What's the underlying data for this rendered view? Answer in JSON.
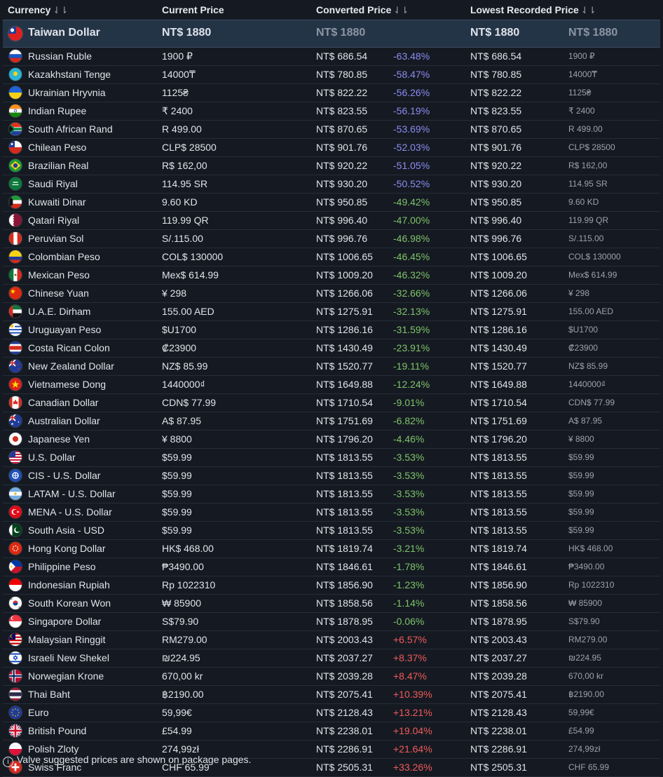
{
  "headers": {
    "currency": "Currency",
    "current": "Current Price",
    "converted": "Converted Price",
    "lowest": "Lowest Recorded Price",
    "sort_glyph": "⇃⇂"
  },
  "base": {
    "name": "Taiwan Dollar",
    "current": "NT$ 1880",
    "converted": "NT$ 1880",
    "lowest": "NT$ 1880",
    "lowest_local": "NT$ 1880",
    "flag": "tw"
  },
  "rows": [
    {
      "flag": "ru",
      "name": "Russian Ruble",
      "current": "1900 ₽",
      "converted": "NT$ 686.54",
      "pct": "-63.48%",
      "tone": "big",
      "lowest": "NT$ 686.54",
      "local": "1900 ₽"
    },
    {
      "flag": "kz",
      "name": "Kazakhstani Tenge",
      "current": "14000₸",
      "converted": "NT$ 780.85",
      "pct": "-58.47%",
      "tone": "big",
      "lowest": "NT$ 780.85",
      "local": "14000₸"
    },
    {
      "flag": "ua",
      "name": "Ukrainian Hryvnia",
      "current": "1125₴",
      "converted": "NT$ 822.22",
      "pct": "-56.26%",
      "tone": "big",
      "lowest": "NT$ 822.22",
      "local": "1125₴"
    },
    {
      "flag": "in",
      "name": "Indian Rupee",
      "current": "₹ 2400",
      "converted": "NT$ 823.55",
      "pct": "-56.19%",
      "tone": "big",
      "lowest": "NT$ 823.55",
      "local": "₹ 2400"
    },
    {
      "flag": "za",
      "name": "South African Rand",
      "current": "R 499.00",
      "converted": "NT$ 870.65",
      "pct": "-53.69%",
      "tone": "big",
      "lowest": "NT$ 870.65",
      "local": "R 499.00"
    },
    {
      "flag": "cl",
      "name": "Chilean Peso",
      "current": "CLP$ 28500",
      "converted": "NT$ 901.76",
      "pct": "-52.03%",
      "tone": "big",
      "lowest": "NT$ 901.76",
      "local": "CLP$ 28500"
    },
    {
      "flag": "br",
      "name": "Brazilian Real",
      "current": "R$ 162,00",
      "converted": "NT$ 920.22",
      "pct": "-51.05%",
      "tone": "big",
      "lowest": "NT$ 920.22",
      "local": "R$ 162,00"
    },
    {
      "flag": "sa",
      "name": "Saudi Riyal",
      "current": "114.95 SR",
      "converted": "NT$ 930.20",
      "pct": "-50.52%",
      "tone": "big",
      "lowest": "NT$ 930.20",
      "local": "114.95 SR"
    },
    {
      "flag": "kw",
      "name": "Kuwaiti Dinar",
      "current": "9.60 KD",
      "converted": "NT$ 950.85",
      "pct": "-49.42%",
      "tone": "neg",
      "lowest": "NT$ 950.85",
      "local": "9.60 KD"
    },
    {
      "flag": "qa",
      "name": "Qatari Riyal",
      "current": "119.99 QR",
      "converted": "NT$ 996.40",
      "pct": "-47.00%",
      "tone": "neg",
      "lowest": "NT$ 996.40",
      "local": "119.99 QR"
    },
    {
      "flag": "pe",
      "name": "Peruvian Sol",
      "current": "S/.115.00",
      "converted": "NT$ 996.76",
      "pct": "-46.98%",
      "tone": "neg",
      "lowest": "NT$ 996.76",
      "local": "S/.115.00"
    },
    {
      "flag": "co",
      "name": "Colombian Peso",
      "current": "COL$ 130000",
      "converted": "NT$ 1006.65",
      "pct": "-46.45%",
      "tone": "neg",
      "lowest": "NT$ 1006.65",
      "local": "COL$ 130000"
    },
    {
      "flag": "mx",
      "name": "Mexican Peso",
      "current": "Mex$ 614.99",
      "converted": "NT$ 1009.20",
      "pct": "-46.32%",
      "tone": "neg",
      "lowest": "NT$ 1009.20",
      "local": "Mex$ 614.99"
    },
    {
      "flag": "cn",
      "name": "Chinese Yuan",
      "current": "¥ 298",
      "converted": "NT$ 1266.06",
      "pct": "-32.66%",
      "tone": "neg",
      "lowest": "NT$ 1266.06",
      "local": "¥ 298"
    },
    {
      "flag": "ae",
      "name": "U.A.E. Dirham",
      "current": "155.00 AED",
      "converted": "NT$ 1275.91",
      "pct": "-32.13%",
      "tone": "neg",
      "lowest": "NT$ 1275.91",
      "local": "155.00 AED"
    },
    {
      "flag": "uy",
      "name": "Uruguayan Peso",
      "current": "$U1700",
      "converted": "NT$ 1286.16",
      "pct": "-31.59%",
      "tone": "neg",
      "lowest": "NT$ 1286.16",
      "local": "$U1700"
    },
    {
      "flag": "cr",
      "name": "Costa Rican Colon",
      "current": "₡23900",
      "converted": "NT$ 1430.49",
      "pct": "-23.91%",
      "tone": "neg",
      "lowest": "NT$ 1430.49",
      "local": "₡23900"
    },
    {
      "flag": "nz",
      "name": "New Zealand Dollar",
      "current": "NZ$ 85.99",
      "converted": "NT$ 1520.77",
      "pct": "-19.11%",
      "tone": "neg",
      "lowest": "NT$ 1520.77",
      "local": "NZ$ 85.99"
    },
    {
      "flag": "vn",
      "name": "Vietnamese Dong",
      "current": "1440000₫",
      "converted": "NT$ 1649.88",
      "pct": "-12.24%",
      "tone": "neg",
      "lowest": "NT$ 1649.88",
      "local": "1440000₫"
    },
    {
      "flag": "ca",
      "name": "Canadian Dollar",
      "current": "CDN$ 77.99",
      "converted": "NT$ 1710.54",
      "pct": "-9.01%",
      "tone": "neg",
      "lowest": "NT$ 1710.54",
      "local": "CDN$ 77.99"
    },
    {
      "flag": "au",
      "name": "Australian Dollar",
      "current": "A$ 87.95",
      "converted": "NT$ 1751.69",
      "pct": "-6.82%",
      "tone": "neg",
      "lowest": "NT$ 1751.69",
      "local": "A$ 87.95"
    },
    {
      "flag": "jp",
      "name": "Japanese Yen",
      "current": "¥ 8800",
      "converted": "NT$ 1796.20",
      "pct": "-4.46%",
      "tone": "neg",
      "lowest": "NT$ 1796.20",
      "local": "¥ 8800"
    },
    {
      "flag": "us",
      "name": "U.S. Dollar",
      "current": "$59.99",
      "converted": "NT$ 1813.55",
      "pct": "-3.53%",
      "tone": "neg",
      "lowest": "NT$ 1813.55",
      "local": "$59.99"
    },
    {
      "flag": "cis",
      "name": "CIS - U.S. Dollar",
      "current": "$59.99",
      "converted": "NT$ 1813.55",
      "pct": "-3.53%",
      "tone": "neg",
      "lowest": "NT$ 1813.55",
      "local": "$59.99"
    },
    {
      "flag": "ar",
      "name": "LATAM - U.S. Dollar",
      "current": "$59.99",
      "converted": "NT$ 1813.55",
      "pct": "-3.53%",
      "tone": "neg",
      "lowest": "NT$ 1813.55",
      "local": "$59.99"
    },
    {
      "flag": "tr",
      "name": "MENA - U.S. Dollar",
      "current": "$59.99",
      "converted": "NT$ 1813.55",
      "pct": "-3.53%",
      "tone": "neg",
      "lowest": "NT$ 1813.55",
      "local": "$59.99"
    },
    {
      "flag": "pk",
      "name": "South Asia - USD",
      "current": "$59.99",
      "converted": "NT$ 1813.55",
      "pct": "-3.53%",
      "tone": "neg",
      "lowest": "NT$ 1813.55",
      "local": "$59.99"
    },
    {
      "flag": "hk",
      "name": "Hong Kong Dollar",
      "current": "HK$ 468.00",
      "converted": "NT$ 1819.74",
      "pct": "-3.21%",
      "tone": "neg",
      "lowest": "NT$ 1819.74",
      "local": "HK$ 468.00"
    },
    {
      "flag": "ph",
      "name": "Philippine Peso",
      "current": "₱3490.00",
      "converted": "NT$ 1846.61",
      "pct": "-1.78%",
      "tone": "neg",
      "lowest": "NT$ 1846.61",
      "local": "₱3490.00"
    },
    {
      "flag": "id",
      "name": "Indonesian Rupiah",
      "current": "Rp 1022310",
      "converted": "NT$ 1856.90",
      "pct": "-1.23%",
      "tone": "neg",
      "lowest": "NT$ 1856.90",
      "local": "Rp 1022310"
    },
    {
      "flag": "kr",
      "name": "South Korean Won",
      "current": "₩ 85900",
      "converted": "NT$ 1858.56",
      "pct": "-1.14%",
      "tone": "neg",
      "lowest": "NT$ 1858.56",
      "local": "₩ 85900"
    },
    {
      "flag": "sg",
      "name": "Singapore Dollar",
      "current": "S$79.90",
      "converted": "NT$ 1878.95",
      "pct": "-0.06%",
      "tone": "neg",
      "lowest": "NT$ 1878.95",
      "local": "S$79.90"
    },
    {
      "flag": "my",
      "name": "Malaysian Ringgit",
      "current": "RM279.00",
      "converted": "NT$ 2003.43",
      "pct": "+6.57%",
      "tone": "pos",
      "lowest": "NT$ 2003.43",
      "local": "RM279.00"
    },
    {
      "flag": "il",
      "name": "Israeli New Shekel",
      "current": "₪224.95",
      "converted": "NT$ 2037.27",
      "pct": "+8.37%",
      "tone": "pos",
      "lowest": "NT$ 2037.27",
      "local": "₪224.95"
    },
    {
      "flag": "no",
      "name": "Norwegian Krone",
      "current": "670,00 kr",
      "converted": "NT$ 2039.28",
      "pct": "+8.47%",
      "tone": "pos",
      "lowest": "NT$ 2039.28",
      "local": "670,00 kr"
    },
    {
      "flag": "th",
      "name": "Thai Baht",
      "current": "฿2190.00",
      "converted": "NT$ 2075.41",
      "pct": "+10.39%",
      "tone": "pos",
      "lowest": "NT$ 2075.41",
      "local": "฿2190.00"
    },
    {
      "flag": "eu",
      "name": "Euro",
      "current": "59,99€",
      "converted": "NT$ 2128.43",
      "pct": "+13.21%",
      "tone": "pos",
      "lowest": "NT$ 2128.43",
      "local": "59,99€"
    },
    {
      "flag": "gb",
      "name": "British Pound",
      "current": "£54.99",
      "converted": "NT$ 2238.01",
      "pct": "+19.04%",
      "tone": "pos",
      "lowest": "NT$ 2238.01",
      "local": "£54.99"
    },
    {
      "flag": "pl",
      "name": "Polish Zloty",
      "current": "274,99zł",
      "converted": "NT$ 2286.91",
      "pct": "+21.64%",
      "tone": "pos",
      "lowest": "NT$ 2286.91",
      "local": "274,99zł"
    },
    {
      "flag": "ch",
      "name": "Swiss Franc",
      "current": "CHF 65.99",
      "converted": "NT$ 2505.31",
      "pct": "+33.26%",
      "tone": "pos",
      "lowest": "NT$ 2505.31",
      "local": "CHF 65.99"
    }
  ],
  "footer": {
    "icon": "info-icon",
    "icon_glyph": "i",
    "text": "Valve suggested prices are shown on package pages."
  },
  "colors": {
    "background": "#151a22",
    "base_row": "#243447",
    "discount_big": "#8c8cf0",
    "discount": "#7fc46a",
    "markup": "#f05a5a"
  }
}
